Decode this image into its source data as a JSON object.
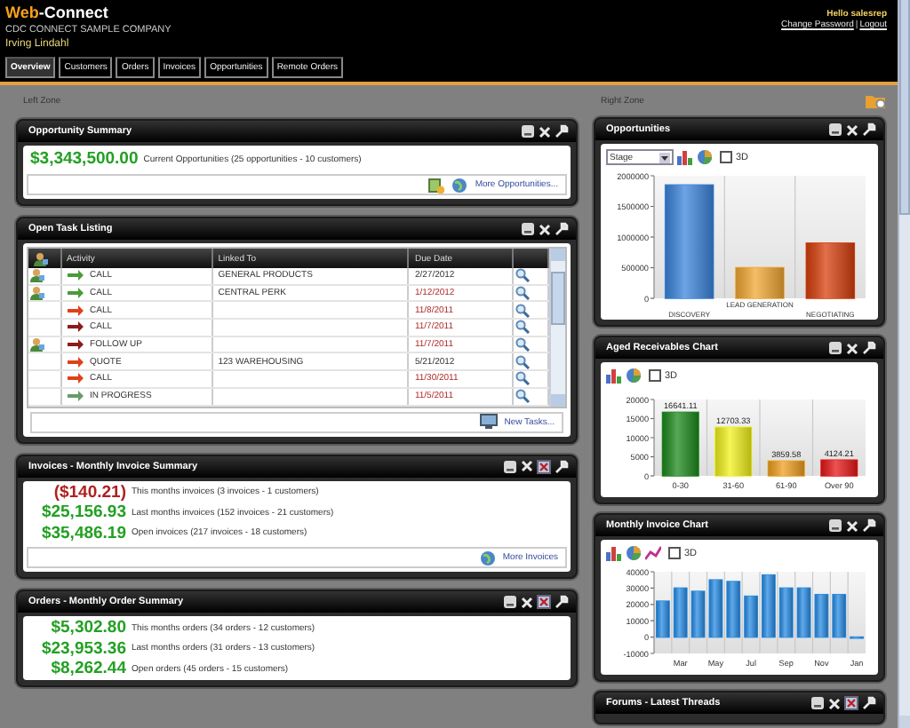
{
  "header": {
    "logo_prefix": "Web",
    "logo_suffix": "-Connect",
    "company": "CDC CONNECT SAMPLE COMPANY",
    "user": "Irving Lindahl",
    "greeting": "Hello salesrep",
    "links": [
      "Change Password",
      "Logout"
    ],
    "link_separator": "|"
  },
  "tabs": [
    {
      "label": "Overview",
      "selected": true
    },
    {
      "label": "Customers",
      "selected": false
    },
    {
      "label": "Orders",
      "selected": false
    },
    {
      "label": "Invoices",
      "selected": false
    },
    {
      "label": "Opportunities",
      "selected": false
    },
    {
      "label": "Remote Orders",
      "selected": false
    }
  ],
  "left_zone": {
    "label": "Left Zone",
    "panels": [
      {
        "kind": "summary",
        "title": "Opportunity Summary",
        "lines": [
          {
            "amount": "$3,343,500.00",
            "text": "Current Opportunities (25 opportunities - 10 customers)",
            "negative": false
          }
        ],
        "footer_link": "More Opportunities...",
        "footer_new_icon": true
      },
      {
        "kind": "tasks",
        "title": "Open Task Listing",
        "columns": [
          "Activity",
          "Linked To",
          "Due Date"
        ],
        "rows": [
          {
            "contact": true,
            "color": "#4a9a3a",
            "activity": "CALL",
            "linked_to": "GENERAL PRODUCTS",
            "due": "2/27/2012",
            "overdue": false
          },
          {
            "contact": true,
            "color": "#4a9a3a",
            "activity": "CALL",
            "linked_to": "CENTRAL PERK",
            "due": "1/12/2012",
            "overdue": true
          },
          {
            "contact": false,
            "color": "#e0401a",
            "activity": "CALL",
            "due": "11/8/2011",
            "overdue": true
          },
          {
            "contact": false,
            "color": "#8e1a1a",
            "activity": "CALL",
            "due": "11/7/2011",
            "overdue": true
          },
          {
            "contact": true,
            "color": "#8e1a1a",
            "activity": "FOLLOW UP",
            "due": "11/7/2011",
            "overdue": true
          },
          {
            "contact": false,
            "color": "#e0401a",
            "activity": "QUOTE",
            "linked_to": "123 WAREHOUSING",
            "due": "5/21/2012",
            "overdue": false
          },
          {
            "contact": false,
            "color": "#e0401a",
            "activity": "CALL",
            "due": "11/30/2011",
            "overdue": true
          },
          {
            "contact": false,
            "color": "#6a9a6a",
            "activity": "IN PROGRESS",
            "due": "11/5/2011",
            "overdue": true
          }
        ],
        "footer_link": "New Tasks..."
      },
      {
        "kind": "summary",
        "title": "Invoices - Monthly Invoice Summary",
        "export_icon": true,
        "lines": [
          {
            "amount": "($140.21)",
            "text": "This months invoices (3 invoices - 1 customers)",
            "negative": true
          },
          {
            "amount": "$25,156.93",
            "text": "Last months invoices (152 invoices - 21 customers)",
            "negative": false
          },
          {
            "amount": "$35,486.19",
            "text": "Open invoices (217 invoices - 18 customers)",
            "negative": false
          }
        ],
        "footer_link": "More Invoices"
      },
      {
        "kind": "summary",
        "title": "Orders - Monthly Order Summary",
        "export_icon": true,
        "lines": [
          {
            "amount": "$5,302.80",
            "text": "This months orders (34 orders - 12 customers)",
            "negative": false
          },
          {
            "amount": "$23,953.36",
            "text": "Last months orders (31 orders - 13 customers)",
            "negative": false
          },
          {
            "amount": "$8,262.44",
            "text": "Open orders (45 orders - 15 customers)",
            "negative": false
          }
        ]
      }
    ]
  },
  "right_zone": {
    "label": "Right Zone",
    "panels": [
      {
        "kind": "chart",
        "title": "Opportunities",
        "select": "Stage",
        "three_d": {
          "label": "3D",
          "checked": false
        },
        "chart_data": {
          "type": "bar",
          "categories": [
            "DISCOVERY",
            "LEAD GENERATION",
            "NEGOTIATING"
          ],
          "series": [
            {
              "color": "#3c86de",
              "values": [
                1850000,
                null,
                null
              ]
            },
            {
              "color": "#f3a834",
              "values": [
                null,
                500000,
                null
              ]
            },
            {
              "color": "#d8400e",
              "values": [
                null,
                null,
                900000
              ]
            }
          ],
          "stacked": true,
          "ylim": [
            0,
            2000000
          ],
          "yticks": [
            0,
            500000,
            1000000,
            1500000,
            2000000
          ]
        }
      },
      {
        "kind": "chart",
        "title": "Aged Receivables Chart",
        "three_d": {
          "label": "3D",
          "checked": false
        },
        "chart_data": {
          "type": "bar",
          "categories": [
            "0-30",
            "31-60",
            "61-90",
            "Over 90"
          ],
          "series": [
            {
              "color": "#1e8a1e",
              "values": [
                16641,
                null,
                null,
                null
              ]
            },
            {
              "color": "#f2f21e",
              "values": [
                null,
                12703,
                null,
                null
              ]
            },
            {
              "color": "#f0a020",
              "values": [
                null,
                null,
                3860,
                null
              ]
            },
            {
              "color": "#e81818",
              "values": [
                null,
                null,
                null,
                4124
              ]
            }
          ],
          "stacked": true,
          "ylim": [
            0,
            20000
          ],
          "yticks": [
            0,
            5000,
            10000,
            15000,
            20000
          ],
          "value_labels": [
            "16641.11",
            "12703.33",
            "3859.58",
            "4124.21"
          ]
        }
      },
      {
        "kind": "chart",
        "title": "Monthly Invoice Chart",
        "line_option": true,
        "three_d": {
          "label": "3D",
          "checked": false
        },
        "chart_data": {
          "type": "bar",
          "categories": [
            null,
            "Mar",
            null,
            "May",
            null,
            "Jul",
            null,
            "Sep",
            null,
            "Nov",
            null,
            "Jan"
          ],
          "series": [
            {
              "color": "#2a8ee6",
              "values": [
                22000,
                30000,
                28000,
                35000,
                34000,
                25000,
                38000,
                30000,
                30000,
                26000,
                26000,
                0
              ]
            }
          ],
          "ylim": [
            -10000,
            40000
          ],
          "yticks": [
            -10000,
            0,
            10000,
            20000,
            30000,
            40000
          ]
        }
      },
      {
        "kind": "chart",
        "title": "Forums - Latest Threads",
        "export_icon": true
      }
    ]
  }
}
